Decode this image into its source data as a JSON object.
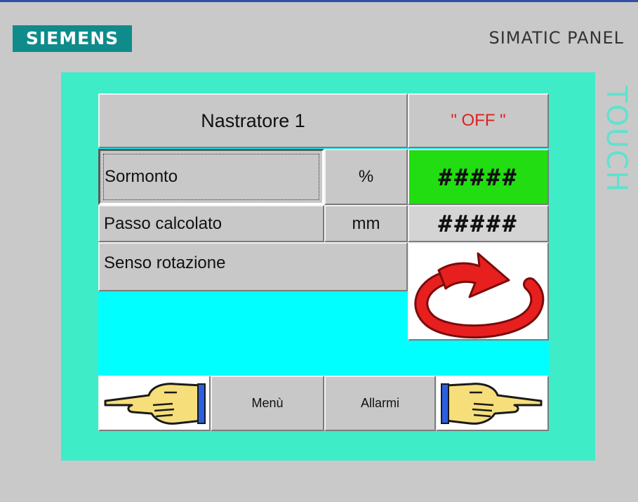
{
  "header": {
    "brand": "SIEMENS",
    "panel_name": "SIMATIC PANEL",
    "side_label": "TOUCH"
  },
  "title_row": {
    "machine_label": "Nastratore 1",
    "status_text": "\" OFF \"",
    "status_color": "#e0201f"
  },
  "rows": [
    {
      "label": "Sormonto",
      "unit": "%",
      "value": "#####",
      "value_bg": "#22dd11"
    },
    {
      "label": "Passo calcolato",
      "unit": "mm",
      "value": "#####",
      "value_bg": "#d4d4d4"
    },
    {
      "label": "Senso rotazione",
      "icon": "rotation-arrow-icon"
    }
  ],
  "footer": {
    "prev_icon": "pointing-hand-left-icon",
    "menu_label": "Menù",
    "alarms_label": "Allarmi",
    "next_icon": "pointing-hand-right-icon"
  },
  "colors": {
    "brand_bg": "#0f8b8b",
    "frame": "#3fecc8",
    "screen": "#00ffff",
    "button": "#c8c8c8"
  }
}
